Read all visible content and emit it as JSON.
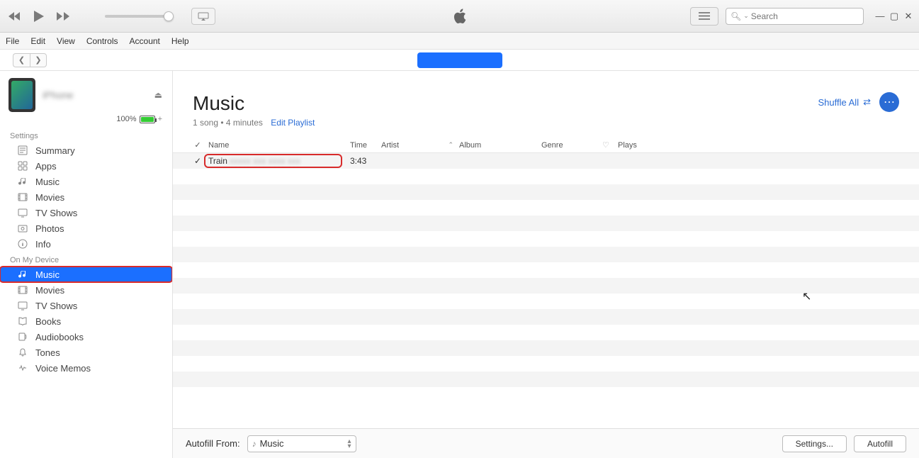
{
  "toolbar": {
    "search_placeholder": "Search"
  },
  "menubar": [
    "File",
    "Edit",
    "View",
    "Controls",
    "Account",
    "Help"
  ],
  "device": {
    "name_blurred": "iPhone",
    "battery_pct": "100%"
  },
  "sidebar": {
    "settings_header": "Settings",
    "settings_items": [
      {
        "icon": "summary",
        "label": "Summary"
      },
      {
        "icon": "apps",
        "label": "Apps"
      },
      {
        "icon": "music",
        "label": "Music"
      },
      {
        "icon": "movies",
        "label": "Movies"
      },
      {
        "icon": "tv",
        "label": "TV Shows"
      },
      {
        "icon": "photos",
        "label": "Photos"
      },
      {
        "icon": "info",
        "label": "Info"
      }
    ],
    "device_header": "On My Device",
    "device_items": [
      {
        "icon": "music",
        "label": "Music",
        "selected": true,
        "highlighted": true
      },
      {
        "icon": "movies",
        "label": "Movies"
      },
      {
        "icon": "tv",
        "label": "TV Shows"
      },
      {
        "icon": "books",
        "label": "Books"
      },
      {
        "icon": "audiobooks",
        "label": "Audiobooks"
      },
      {
        "icon": "tones",
        "label": "Tones"
      },
      {
        "icon": "voice",
        "label": "Voice Memos"
      }
    ]
  },
  "content": {
    "title": "Music",
    "sub": "1 song • 4 minutes",
    "edit_link": "Edit Playlist",
    "shuffle": "Shuffle All"
  },
  "columns": {
    "name": "Name",
    "time": "Time",
    "artist": "Artist",
    "album": "Album",
    "genre": "Genre",
    "plays": "Plays"
  },
  "rows": [
    {
      "checked": true,
      "name": "Train",
      "name_rest_blurred": true,
      "time": "3:43",
      "artist": "",
      "album": "",
      "genre": "",
      "plays": "",
      "highlighted": true
    }
  ],
  "footer": {
    "autofill_label": "Autofill From:",
    "autofill_select": "Music",
    "settings_btn": "Settings...",
    "autofill_btn": "Autofill"
  }
}
